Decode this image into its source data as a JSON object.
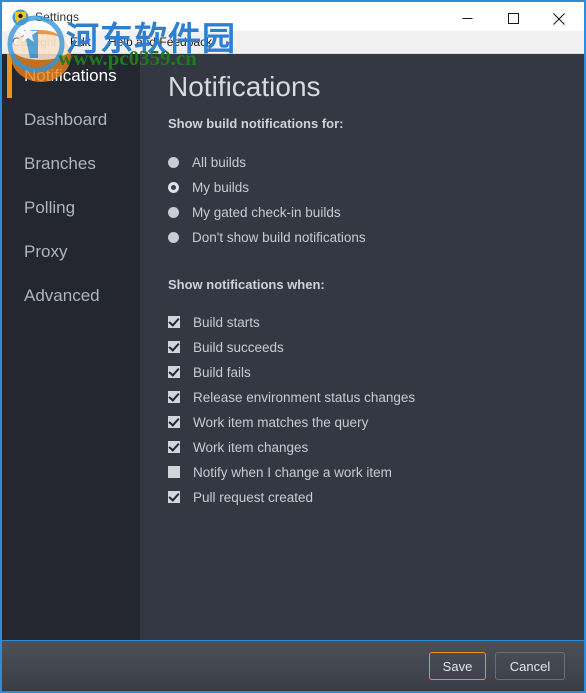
{
  "window": {
    "title": "Settings",
    "accent_blue": "#2e8bd8",
    "accent_orange": "#f0921e",
    "sidebar_bg": "#24272f",
    "content_bg": "#343842",
    "controls": {
      "minimize": "minimize-icon",
      "maximize": "maximize-icon",
      "close": "close-icon"
    }
  },
  "menubar": {
    "items": [
      {
        "label": "CatLight"
      },
      {
        "label": "Edit"
      },
      {
        "label": "Help and Feedback"
      }
    ]
  },
  "sidebar": {
    "items": [
      {
        "label": "Notifications",
        "active": true
      },
      {
        "label": "Dashboard",
        "active": false
      },
      {
        "label": "Branches",
        "active": false
      },
      {
        "label": "Polling",
        "active": false
      },
      {
        "label": "Proxy",
        "active": false
      },
      {
        "label": "Advanced",
        "active": false
      }
    ]
  },
  "content": {
    "title": "Notifications",
    "build_section": {
      "heading": "Show build notifications for:",
      "options": [
        {
          "label": "All builds",
          "selected": false
        },
        {
          "label": "My builds",
          "selected": true
        },
        {
          "label": "My gated check-in builds",
          "selected": false
        },
        {
          "label": "Don't show build notifications",
          "selected": false
        }
      ]
    },
    "when_section": {
      "heading": "Show notifications when:",
      "options": [
        {
          "label": "Build starts",
          "checked": true
        },
        {
          "label": "Build succeeds",
          "checked": true
        },
        {
          "label": "Build fails",
          "checked": true
        },
        {
          "label": "Release environment status changes",
          "checked": true
        },
        {
          "label": "Work item matches the query",
          "checked": true
        },
        {
          "label": "Work item changes",
          "checked": true
        },
        {
          "label": "Notify when I change a work item",
          "checked": false
        },
        {
          "label": "Pull request created",
          "checked": true
        }
      ]
    }
  },
  "footer": {
    "save_label": "Save",
    "cancel_label": "Cancel"
  },
  "watermark": {
    "chinese": "河东软件园",
    "url": "www.pc0359.cn",
    "chinese_color": "#2f7fd0",
    "url_color": "#1f7a1f"
  }
}
